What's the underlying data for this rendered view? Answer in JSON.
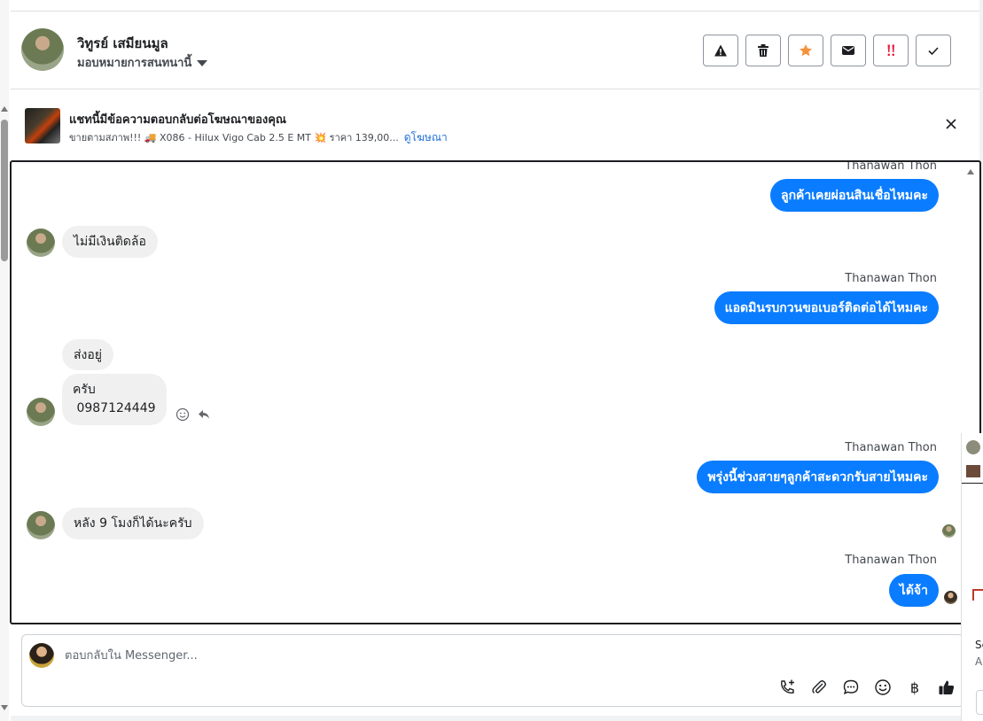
{
  "header": {
    "contact_name": "วิทูรย์ เสมียนมูล",
    "assign_label": "มอบหมายการสนทนานี้",
    "actions": [
      {
        "name": "spam",
        "icon": "warning-icon"
      },
      {
        "name": "delete",
        "icon": "trash-icon"
      },
      {
        "name": "star",
        "icon": "star-icon",
        "color": "#f7923a"
      },
      {
        "name": "unread",
        "icon": "envelope-icon"
      },
      {
        "name": "follow-up",
        "icon": "exclamation-icon",
        "color": "#e41e3f"
      },
      {
        "name": "done",
        "icon": "check-icon"
      }
    ]
  },
  "ad": {
    "title": "แชทนี้มีข้อความตอบกลับต่อโฆษณาของคุณ",
    "description": "ขายตามสภาพ!!! 🚚 X086 - Hilux Vigo Cab 2.5 E MT 💥 ราคา 139,00...",
    "view_ad_link": "ดูโฆษณา"
  },
  "messages": [
    {
      "dir": "out",
      "sender": "Thanawan Thon",
      "text": "ลูกค้าเคยผ่อนสินเชื่อไหมคะ"
    },
    {
      "dir": "in",
      "text": "ไม่มีเงินติดล้อ"
    },
    {
      "dir": "out",
      "sender": "Thanawan Thon",
      "text": "แอดมินรบกวนขอเบอร์ติดต่อได้ไหมคะ"
    },
    {
      "dir": "in",
      "text": "ส่งอยู่"
    },
    {
      "dir": "in",
      "text": "ครับ\n 0987124449"
    },
    {
      "dir": "out",
      "sender": "Thanawan Thon",
      "text": "พรุ่งนี้ช่วงสายๆลูกค้าสะดวกรับสายไหมคะ"
    },
    {
      "dir": "in",
      "text": "หลัง 9 โมงก็ได้นะครับ"
    },
    {
      "dir": "out",
      "sender": "Thanawan Thon",
      "text": "ได้จ้า"
    }
  ],
  "composer": {
    "placeholder": "ตอบกลับใน Messenger...",
    "icons": [
      "call-add-icon",
      "attachment-icon",
      "saved-reply-icon",
      "emoji-icon",
      "baht-icon",
      "like-icon"
    ],
    "baht_symbol": "฿"
  },
  "side_panel": {
    "line1": "Se",
    "line2": "A"
  },
  "colors": {
    "outgoing_bubble": "#0a7cff",
    "incoming_bubble": "#f0f0f0",
    "link": "#216fdb"
  }
}
